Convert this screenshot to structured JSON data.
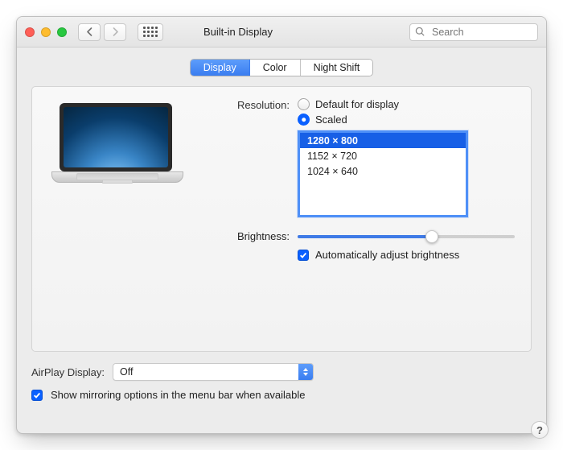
{
  "window": {
    "title": "Built-in Display"
  },
  "search": {
    "placeholder": "Search"
  },
  "tabs": [
    {
      "label": "Display",
      "active": true
    },
    {
      "label": "Color",
      "active": false
    },
    {
      "label": "Night Shift",
      "active": false
    }
  ],
  "resolution": {
    "label": "Resolution:",
    "default_label": "Default for display",
    "scaled_label": "Scaled",
    "mode": "scaled",
    "options": [
      {
        "label": "1280 × 800",
        "selected": true
      },
      {
        "label": "1152 × 720",
        "selected": false
      },
      {
        "label": "1024 × 640",
        "selected": false
      }
    ]
  },
  "brightness": {
    "label": "Brightness:",
    "value_percent": 62,
    "auto_label": "Automatically adjust brightness",
    "auto_checked": true
  },
  "airplay": {
    "label": "AirPlay Display:",
    "value": "Off"
  },
  "mirroring": {
    "label": "Show mirroring options in the menu bar when available",
    "checked": true
  },
  "help": {
    "label": "?"
  }
}
